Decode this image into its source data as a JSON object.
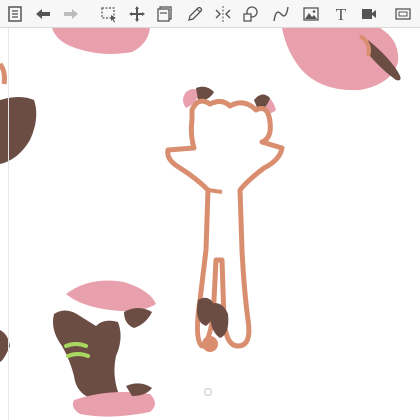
{
  "app": {
    "accent_color": "#555555",
    "canvas_background": "#ffffff"
  },
  "toolbar": {
    "items": [
      {
        "icon": "menu-icon",
        "enabled": true
      },
      {
        "icon": "undo-icon",
        "enabled": true
      },
      {
        "icon": "redo-icon",
        "enabled": false
      },
      {
        "icon": "select-icon",
        "enabled": true
      },
      {
        "icon": "move-icon",
        "enabled": true
      },
      {
        "icon": "layers-icon",
        "enabled": true
      },
      {
        "icon": "pencil-icon",
        "enabled": true
      },
      {
        "icon": "symmetry-icon",
        "enabled": true
      },
      {
        "icon": "shapes-icon",
        "enabled": true
      },
      {
        "icon": "curve-icon",
        "enabled": true
      },
      {
        "icon": "image-icon",
        "enabled": true
      },
      {
        "icon": "text-icon",
        "enabled": true,
        "label": "T"
      },
      {
        "icon": "video-icon",
        "enabled": true
      },
      {
        "icon": "fullscreen-icon",
        "enabled": true
      }
    ]
  },
  "drawing": {
    "colors": {
      "pink": "#e9a0ad",
      "brown": "#6b4d44",
      "outline": "#d98e70",
      "green": "#a8d860"
    }
  }
}
